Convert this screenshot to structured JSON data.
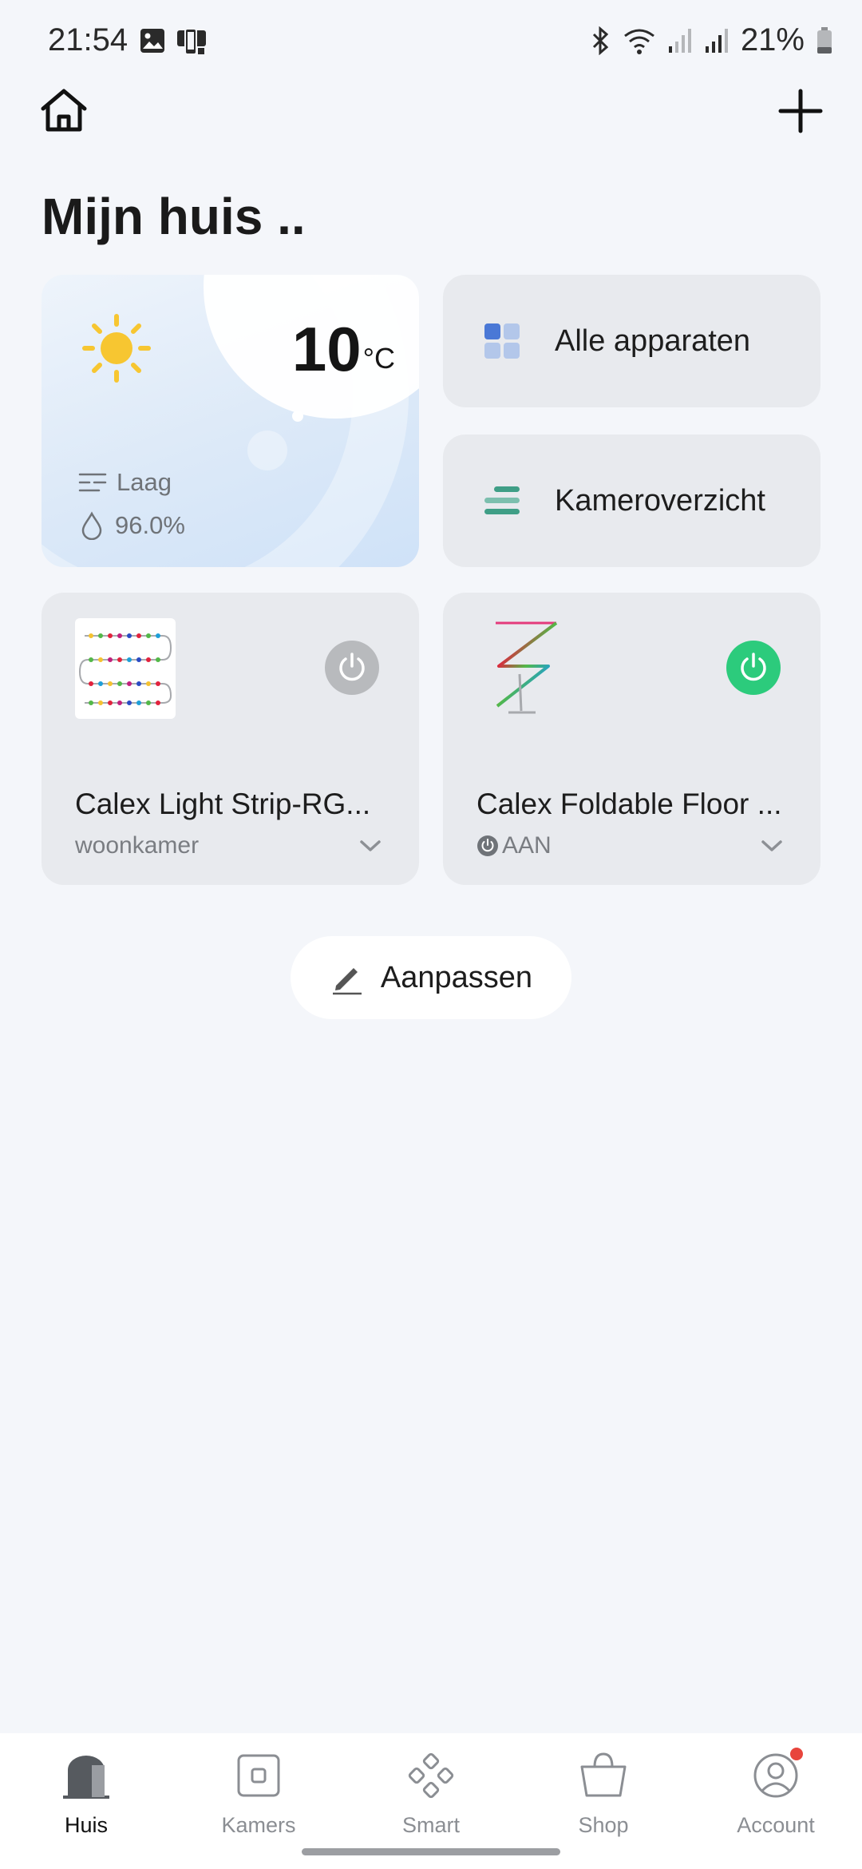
{
  "status_bar": {
    "time": "21:54",
    "battery": "21%"
  },
  "header": {
    "title": "Mijn huis .."
  },
  "weather": {
    "temperature": "10",
    "unit": "°C",
    "level_label": "Laag",
    "humidity": "96.0%"
  },
  "quick_links": [
    {
      "label": "Alle apparaten",
      "icon": "grid-icon"
    },
    {
      "label": "Kameroverzicht",
      "icon": "rooms-list-icon"
    }
  ],
  "devices": [
    {
      "name": "Calex Light Strip-RG...",
      "sub": "woonkamer",
      "power": "off"
    },
    {
      "name": "Calex Foldable Floor ...",
      "sub": "AAN",
      "power": "on"
    }
  ],
  "edit_button": {
    "label": "Aanpassen"
  },
  "bottom_nav": {
    "tabs": [
      {
        "label": "Huis",
        "active": true
      },
      {
        "label": "Kamers"
      },
      {
        "label": "Smart"
      },
      {
        "label": "Shop"
      },
      {
        "label": "Account",
        "badge": true
      }
    ]
  },
  "colors": {
    "power_on": "#2ccb7c",
    "power_off": "#b8babd",
    "badge": "#e8453c"
  }
}
